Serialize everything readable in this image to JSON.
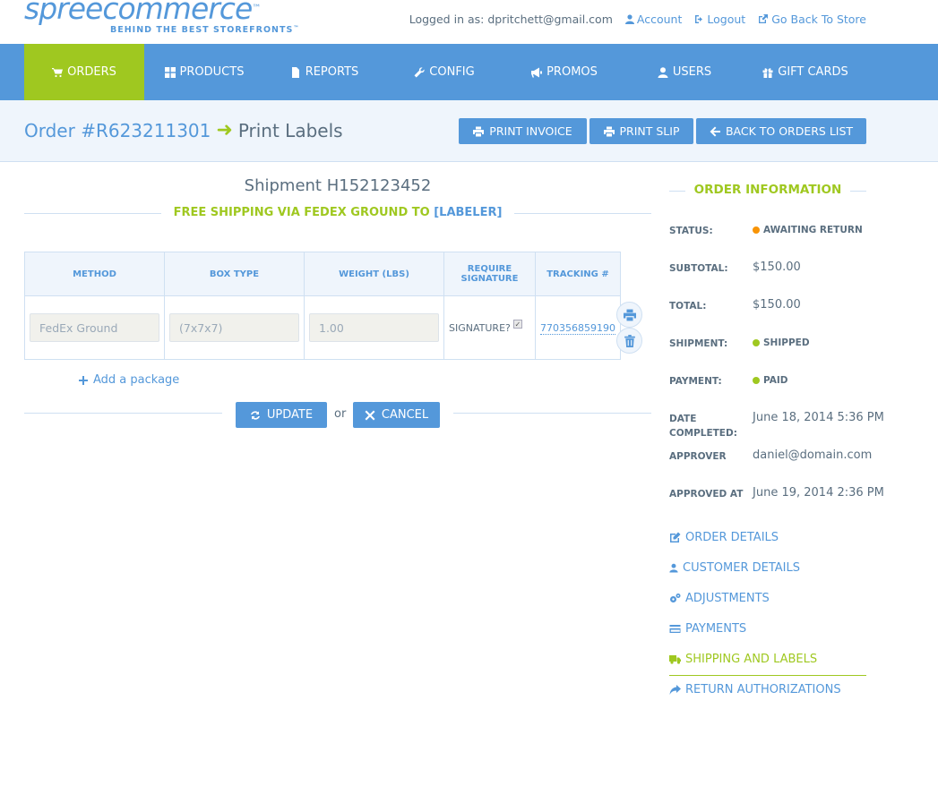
{
  "brand": {
    "name": "spreecommerce",
    "trademark": "™",
    "tagline": "BEHIND THE BEST STOREFRONTS"
  },
  "topnav": {
    "logged_in": "Logged in as: dpritchett@gmail.com",
    "account": "Account",
    "logout": "Logout",
    "back_to_store": "Go Back To Store"
  },
  "mainnav": {
    "items": [
      {
        "label": "ORDERS",
        "icon": "cart-icon",
        "active": true
      },
      {
        "label": "PRODUCTS",
        "icon": "grid-icon"
      },
      {
        "label": "REPORTS",
        "icon": "file-icon"
      },
      {
        "label": "CONFIG",
        "icon": "wrench-icon"
      },
      {
        "label": "PROMOS",
        "icon": "bullhorn-icon"
      },
      {
        "label": "USERS",
        "icon": "user-icon"
      },
      {
        "label": "GIFT CARDS",
        "icon": "gift-icon"
      }
    ]
  },
  "page": {
    "order": "Order #R623211301",
    "arrow": "➜",
    "subtitle": "Print Labels",
    "buttons": {
      "print_invoice": "PRINT INVOICE",
      "print_slip": "PRINT SLIP",
      "back_to_orders": "BACK TO ORDERS LIST"
    }
  },
  "shipment": {
    "title": "Shipment H152123452",
    "method_text": "FREE SHIPPING VIA FEDEX GROUND TO",
    "labeler": "[LABELER]",
    "columns": [
      "METHOD",
      "BOX TYPE",
      "WEIGHT (LBS)",
      "REQUIRE SIGNATURE",
      "TRACKING #"
    ],
    "row": {
      "method": "FedEx Ground",
      "box_type": "(7x7x7)",
      "weight": "1.00",
      "signature_label": "SIGNATURE?",
      "signature_checked": true,
      "tracking": "770356859190"
    },
    "add_package": "Add a package",
    "update": "UPDATE",
    "or": "or",
    "cancel": "CANCEL"
  },
  "sidebar": {
    "heading": "ORDER INFORMATION",
    "info": [
      {
        "label": "STATUS:",
        "value": "AWAITING RETURN",
        "type": "pill",
        "color": "#f89406"
      },
      {
        "label": "SUBTOTAL:",
        "value": "$150.00"
      },
      {
        "label": "TOTAL:",
        "value": "$150.00"
      },
      {
        "label": "SHIPMENT:",
        "value": "SHIPPED",
        "type": "pill",
        "color": "#9fc820"
      },
      {
        "label": "PAYMENT:",
        "value": "PAID",
        "type": "pill",
        "color": "#9fc820"
      },
      {
        "label": "DATE COMPLETED:",
        "value": "June 18, 2014 5:36 PM"
      },
      {
        "label": "APPROVER",
        "value": "daniel@domain.com"
      },
      {
        "label": "APPROVED AT",
        "value": "June 19, 2014 2:36 PM"
      }
    ],
    "links": [
      {
        "label": "ORDER DETAILS",
        "icon": "edit-icon"
      },
      {
        "label": "CUSTOMER DETAILS",
        "icon": "user-icon"
      },
      {
        "label": "ADJUSTMENTS",
        "icon": "cogs-icon"
      },
      {
        "label": "PAYMENTS",
        "icon": "credit-card-icon"
      },
      {
        "label": "SHIPPING AND LABELS",
        "icon": "truck-icon",
        "active": true
      },
      {
        "label": "RETURN AUTHORIZATIONS",
        "icon": "share-icon"
      }
    ]
  },
  "colors": {
    "primary": "#5498da",
    "accent": "#9fc820",
    "warning": "#f89406",
    "text": "#5a6e7f"
  }
}
